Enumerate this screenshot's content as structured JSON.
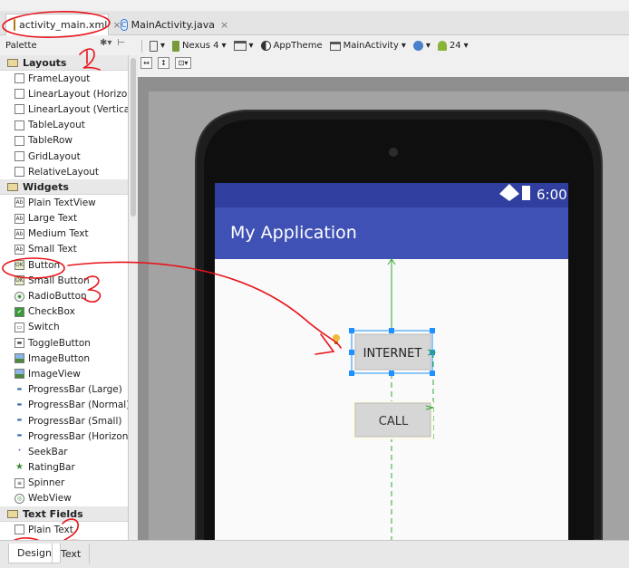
{
  "tabs": [
    {
      "label": "activity_main.xml",
      "active": true
    },
    {
      "label": "MainActivity.java",
      "active": false
    }
  ],
  "palette": {
    "title": "Palette",
    "categories": [
      {
        "label": "Layouts",
        "items": [
          {
            "label": "FrameLayout",
            "icon": "frame-layout-icon"
          },
          {
            "label": "LinearLayout (Horizontal)",
            "icon": "linear-horizontal-icon"
          },
          {
            "label": "LinearLayout (Vertical)",
            "icon": "linear-vertical-icon"
          },
          {
            "label": "TableLayout",
            "icon": "table-layout-icon"
          },
          {
            "label": "TableRow",
            "icon": "table-row-icon"
          },
          {
            "label": "GridLayout",
            "icon": "grid-layout-icon"
          },
          {
            "label": "RelativeLayout",
            "icon": "relative-layout-icon"
          }
        ]
      },
      {
        "label": "Widgets",
        "items": [
          {
            "label": "Plain TextView",
            "icon": "textview-icon"
          },
          {
            "label": "Large Text",
            "icon": "textview-icon"
          },
          {
            "label": "Medium Text",
            "icon": "textview-icon"
          },
          {
            "label": "Small Text",
            "icon": "textview-icon"
          },
          {
            "label": "Button",
            "icon": "button-icon"
          },
          {
            "label": "Small Button",
            "icon": "button-icon"
          },
          {
            "label": "RadioButton",
            "icon": "radio-icon"
          },
          {
            "label": "CheckBox",
            "icon": "checkbox-icon"
          },
          {
            "label": "Switch",
            "icon": "switch-icon"
          },
          {
            "label": "ToggleButton",
            "icon": "toggle-icon"
          },
          {
            "label": "ImageButton",
            "icon": "image-button-icon"
          },
          {
            "label": "ImageView",
            "icon": "image-view-icon"
          },
          {
            "label": "ProgressBar (Large)",
            "icon": "progressbar-icon"
          },
          {
            "label": "ProgressBar (Normal)",
            "icon": "progressbar-icon"
          },
          {
            "label": "ProgressBar (Small)",
            "icon": "progressbar-icon"
          },
          {
            "label": "ProgressBar (Horizontal)",
            "icon": "progressbar-icon"
          },
          {
            "label": "SeekBar",
            "icon": "seekbar-icon"
          },
          {
            "label": "RatingBar",
            "icon": "star-icon"
          },
          {
            "label": "Spinner",
            "icon": "spinner-icon"
          },
          {
            "label": "WebView",
            "icon": "webview-icon"
          }
        ]
      },
      {
        "label": "Text Fields",
        "items": [
          {
            "label": "Plain Text",
            "icon": "edittext-icon"
          }
        ]
      }
    ]
  },
  "toolbar": {
    "device": "Nexus 4",
    "theme": "AppTheme",
    "activity": "MainActivity",
    "api": "24"
  },
  "phone": {
    "time": "6:00",
    "app_title": "My Application",
    "button1": "INTERNET",
    "button2": "CALL"
  },
  "annotations": [
    "1",
    "2",
    "3"
  ],
  "bottom_tabs": [
    {
      "label": "Design",
      "active": true
    },
    {
      "label": "Text",
      "active": false
    }
  ],
  "colors": {
    "primary": "#3f51b5",
    "status_bar": "#303f9f",
    "annotation": "#e8141c",
    "selection": "#1e90ff",
    "guide": "#2fa82f"
  }
}
